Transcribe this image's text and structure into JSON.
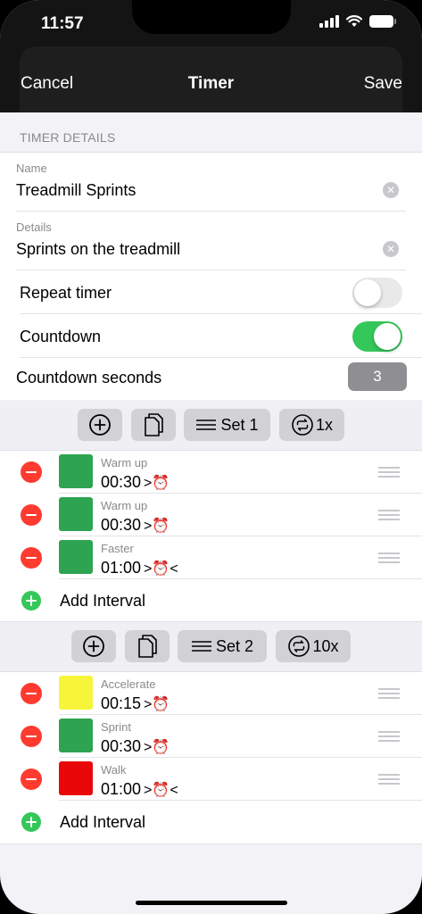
{
  "status_bar": {
    "time": "11:57"
  },
  "nav": {
    "cancel": "Cancel",
    "title": "Timer",
    "save": "Save"
  },
  "details": {
    "section_header": "TIMER DETAILS",
    "name_label": "Name",
    "name_value": "Treadmill Sprints",
    "details_label": "Details",
    "details_value": "Sprints on the treadmill",
    "repeat_label": "Repeat timer",
    "repeat_on": false,
    "countdown_label": "Countdown",
    "countdown_on": true,
    "countdown_seconds_label": "Countdown seconds",
    "countdown_seconds": "3"
  },
  "sets": [
    {
      "name": "Set 1",
      "repeat": "1x",
      "intervals": [
        {
          "name": "Warm up",
          "time": "00:30",
          "color": "#2ea352",
          "indicator": ">⏰"
        },
        {
          "name": "Warm up",
          "time": "00:30",
          "color": "#2ea352",
          "indicator": ">⏰"
        },
        {
          "name": "Faster",
          "time": "01:00",
          "color": "#2ea352",
          "indicator": ">⏰<"
        }
      ],
      "add_label": "Add Interval"
    },
    {
      "name": "Set 2",
      "repeat": "10x",
      "intervals": [
        {
          "name": "Accelerate",
          "time": "00:15",
          "color": "#f7f53a",
          "indicator": ">⏰"
        },
        {
          "name": "Sprint",
          "time": "00:30",
          "color": "#2ea352",
          "indicator": ">⏰"
        },
        {
          "name": "Walk",
          "time": "01:00",
          "color": "#e8080a",
          "indicator": ">⏰<"
        }
      ],
      "add_label": "Add Interval"
    }
  ]
}
